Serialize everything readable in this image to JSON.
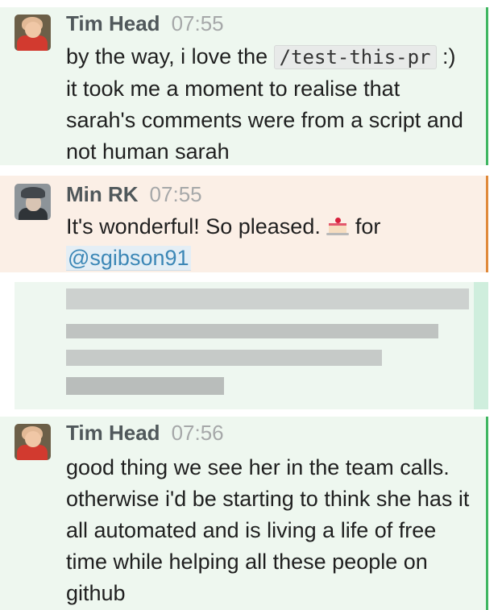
{
  "messages": [
    {
      "author": "Tim Head",
      "time": "07:55",
      "text_before": "by the way, i love the",
      "code": "/test-this-pr",
      "text_after": ":) it took me a moment to realise that sarah's comments were from a script and not human sarah"
    },
    {
      "author": "Min RK",
      "time": "07:55",
      "text_before": "It's wonderful! So pleased.",
      "text_after": "for",
      "mention": "@sgibson91"
    },
    {
      "author": "Tim Head",
      "time": "07:56",
      "text": "good thing we see her in the team calls. otherwise i'd be starting to think she has it all automated and is living a life of free time while helping all these people on github"
    }
  ],
  "colors": {
    "tim_bg": "#eef7ef",
    "tim_accent": "#3fb661",
    "min_bg": "#fbefe6",
    "min_accent": "#e0893a",
    "mention": "#3c87b6"
  },
  "icons": [
    "user-avatar-tim",
    "user-avatar-min",
    "cake-emoji-icon"
  ]
}
